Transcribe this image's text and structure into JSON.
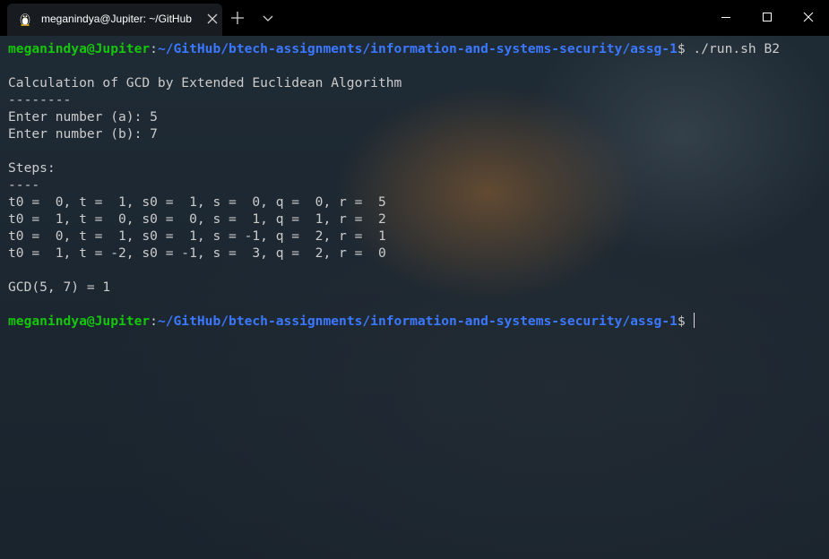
{
  "tab": {
    "title": "meganindya@Jupiter: ~/GitHub",
    "icon": "linux-penguin-icon"
  },
  "titlebar": {
    "new_tab_icon": "plus-icon",
    "dropdown_icon": "chevron-down-icon",
    "controls": [
      "minimize-icon",
      "maximize-icon",
      "close-icon"
    ]
  },
  "colors": {
    "prompt_user": "#16c60c",
    "prompt_path": "#3b78ff",
    "text": "#cccccc",
    "titlebar": "#000000"
  },
  "terminal": {
    "prompt1": {
      "user_host": "meganindya@Jupiter",
      "colon": ":",
      "path": "~/GitHub/btech-assignments/information-and-systems-security/assg-1",
      "dollar": "$",
      "command": " ./run.sh B2"
    },
    "lines": [
      "",
      "Calculation of GCD by Extended Euclidean Algorithm",
      "--------",
      "Enter number (a): 5",
      "Enter number (b): 7",
      "",
      "Steps:",
      "----",
      "t0 =  0, t =  1, s0 =  1, s =  0, q =  0, r =  5",
      "t0 =  1, t =  0, s0 =  0, s =  1, q =  1, r =  2",
      "t0 =  0, t =  1, s0 =  1, s = -1, q =  2, r =  1",
      "t0 =  1, t = -2, s0 = -1, s =  3, q =  2, r =  0",
      "",
      "GCD(5, 7) = 1",
      ""
    ],
    "prompt2": {
      "user_host": "meganindya@Jupiter",
      "colon": ":",
      "path": "~/GitHub/btech-assignments/information-and-systems-security/assg-1",
      "dollar": "$",
      "command": " "
    }
  }
}
